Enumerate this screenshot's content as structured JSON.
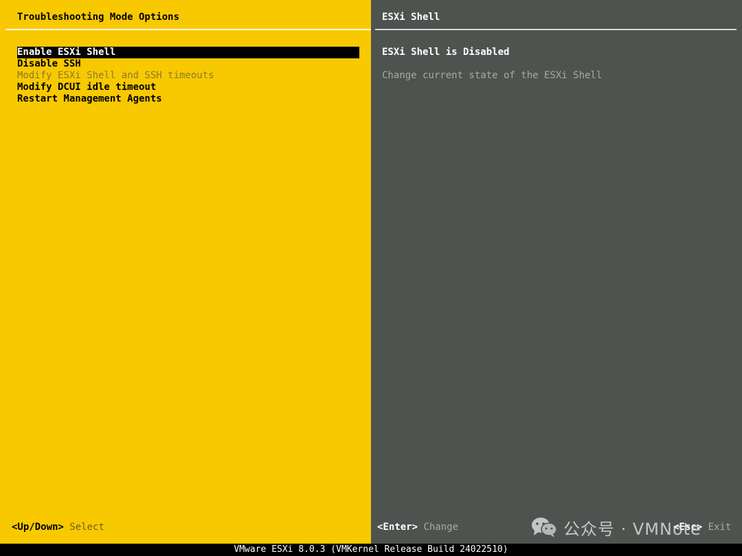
{
  "left_panel": {
    "title": "Troubleshooting Mode Options",
    "menu": [
      {
        "label": "Enable ESXi Shell",
        "state": "selected"
      },
      {
        "label": "Disable SSH",
        "state": "normal"
      },
      {
        "label": "Modify ESXi Shell and SSH timeouts",
        "state": "dimmed"
      },
      {
        "label": "Modify DCUI idle timeout",
        "state": "normal"
      },
      {
        "label": "Restart Management Agents",
        "state": "normal"
      }
    ],
    "hint": {
      "key": "<Up/Down>",
      "action": "Select"
    }
  },
  "right_panel": {
    "title": "ESXi Shell",
    "status": "ESXi Shell is Disabled",
    "description": "Change current state of the ESXi Shell",
    "hint_change": {
      "key": "<Enter>",
      "action": "Change"
    },
    "hint_exit": {
      "key": "<Esc>",
      "action": "Exit"
    }
  },
  "watermark": {
    "icon": "wechat-icon",
    "text": "公众号 · VMNote"
  },
  "footer": {
    "text": "VMware ESXi 8.0.3 (VMKernel Release Build 24022510)"
  },
  "colors": {
    "left_panel_bg": "#f8c900",
    "right_panel_bg": "#4f5350",
    "selection_bg": "#000000",
    "selection_fg": "#ffffff",
    "footer_bg": "#000000"
  }
}
